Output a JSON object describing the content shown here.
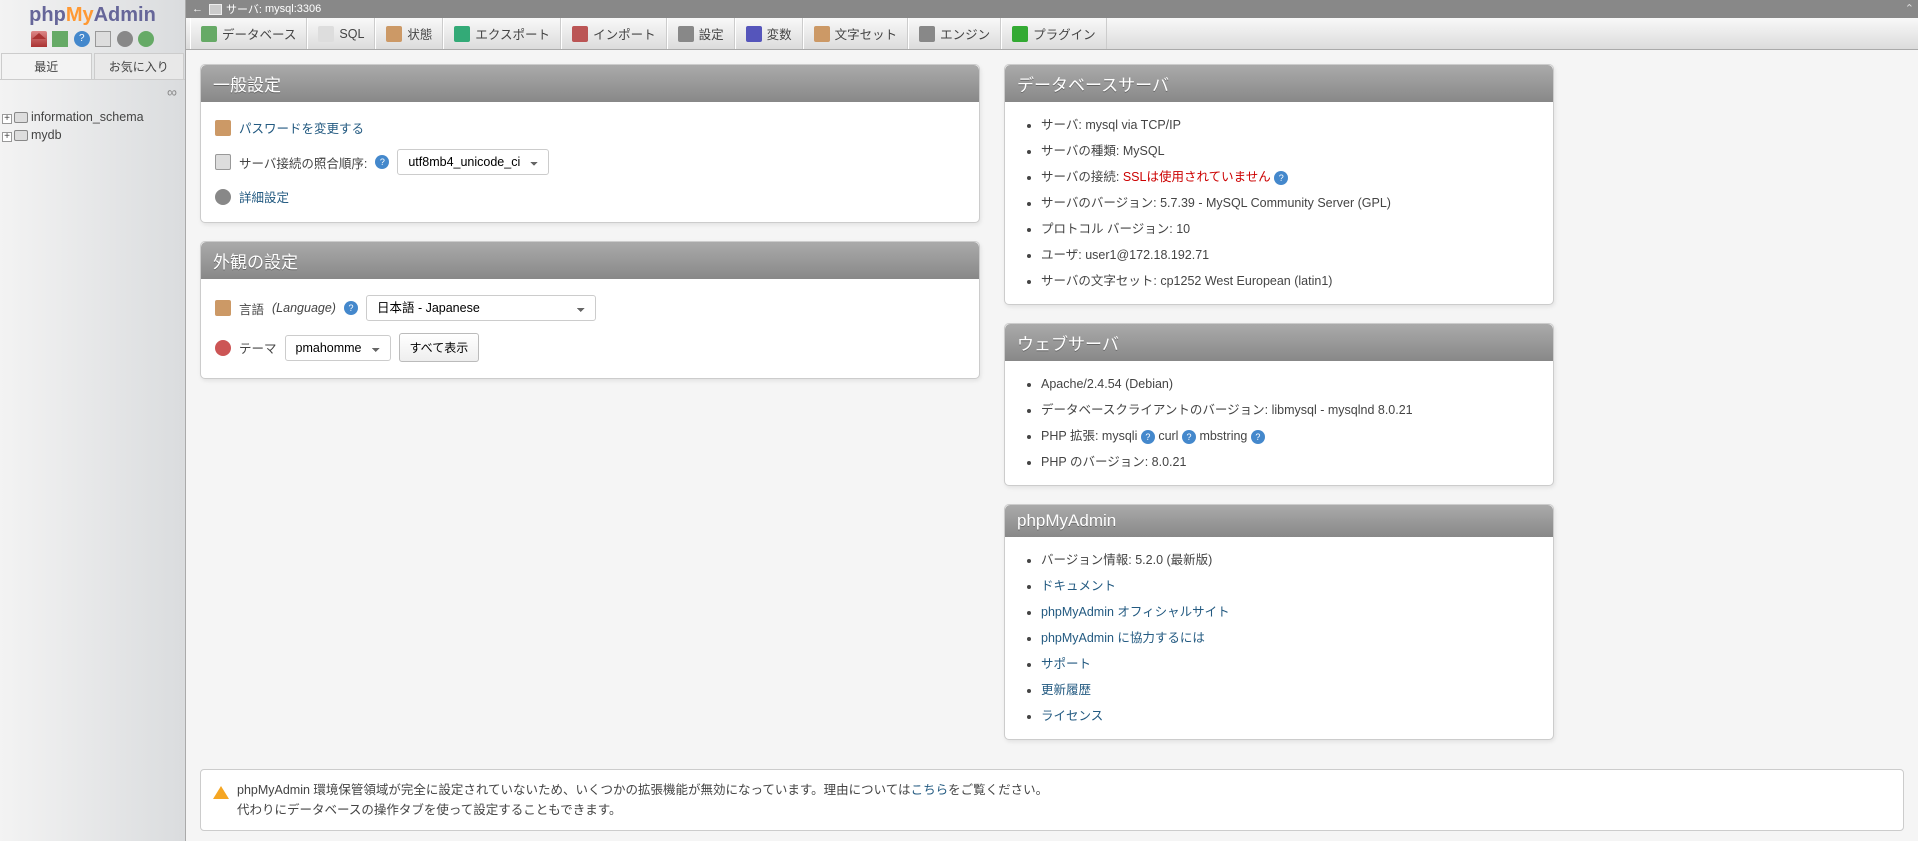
{
  "logo": {
    "p": "php",
    "m": "My",
    "a": "Admin"
  },
  "sidebar": {
    "tabs": [
      "最近",
      "お気に入り"
    ],
    "dbs": [
      "information_schema",
      "mydb"
    ]
  },
  "server": {
    "label": "サーバ:",
    "name": "mysql:3306"
  },
  "nav": [
    {
      "label": "データベース",
      "c": "#6a6"
    },
    {
      "label": "SQL",
      "c": "#ddd"
    },
    {
      "label": "状態",
      "c": "#c96"
    },
    {
      "label": "エクスポート",
      "c": "#3a7"
    },
    {
      "label": "インポート",
      "c": "#b55"
    },
    {
      "label": "設定",
      "c": "#888"
    },
    {
      "label": "変数",
      "c": "#55b"
    },
    {
      "label": "文字セット",
      "c": "#c96"
    },
    {
      "label": "エンジン",
      "c": "#888"
    },
    {
      "label": "プラグイン",
      "c": "#3a3"
    }
  ],
  "general": {
    "title": "一般設定",
    "changepw": "パスワードを変更する",
    "collation_label": "サーバ接続の照合順序:",
    "collation_value": "utf8mb4_unicode_ci",
    "more": "詳細設定"
  },
  "appearance": {
    "title": "外観の設定",
    "lang_label": "言語",
    "lang_paren": "(Language)",
    "lang_value": "日本語 - Japanese",
    "theme_label": "テーマ",
    "theme_value": "pmahomme",
    "view_all": "すべて表示"
  },
  "dbserver": {
    "title": "データベースサーバ",
    "items": [
      {
        "k": "サーバ:",
        "v": "mysql via TCP/IP"
      },
      {
        "k": "サーバの種類:",
        "v": "MySQL"
      },
      {
        "k": "サーバの接続:",
        "v": "SSLは使用されていません",
        "red": true,
        "help": true
      },
      {
        "k": "サーバのバージョン:",
        "v": "5.7.39 - MySQL Community Server (GPL)"
      },
      {
        "k": "プロトコル バージョン:",
        "v": "10"
      },
      {
        "k": "ユーザ:",
        "v": "user1@172.18.192.71"
      },
      {
        "k": "サーバの文字セット:",
        "v": "cp1252 West European (latin1)"
      }
    ]
  },
  "webserver": {
    "title": "ウェブサーバ",
    "apache": "Apache/2.4.54 (Debian)",
    "client_label": "データベースクライアントのバージョン:",
    "client_val": "libmysql - mysqlnd 8.0.21",
    "phpext_label": "PHP 拡張:",
    "phpext": [
      "mysqli",
      "curl",
      "mbstring"
    ],
    "phpver_label": "PHP のバージョン:",
    "phpver_val": "8.0.21"
  },
  "pma": {
    "title": "phpMyAdmin",
    "ver_label": "バージョン情報:",
    "ver_val": "5.2.0 (最新版)",
    "links": [
      "ドキュメント",
      "phpMyAdmin オフィシャルサイト",
      "phpMyAdmin に協力するには",
      "サポート",
      "更新履歴",
      "ライセンス"
    ]
  },
  "notice": {
    "pre": "phpMyAdmin 環境保管領域が完全に設定されていないため、いくつかの拡張機能が無効になっています。理由については",
    "link": "こちら",
    "post": "をご覧ください。",
    "line2": "代わりにデータベースの操作タブを使って設定することもできます。"
  }
}
